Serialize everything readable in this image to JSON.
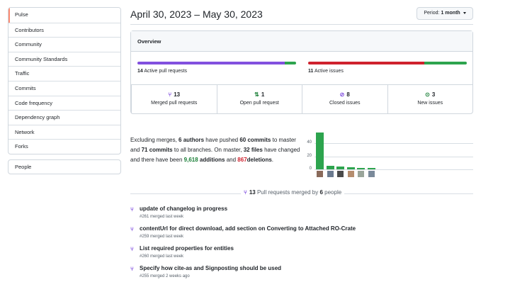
{
  "sidebar": {
    "items": [
      {
        "label": "Pulse"
      },
      {
        "label": "Contributors"
      },
      {
        "label": "Community"
      },
      {
        "label": "Community Standards"
      },
      {
        "label": "Traffic"
      },
      {
        "label": "Commits"
      },
      {
        "label": "Code frequency"
      },
      {
        "label": "Dependency graph"
      },
      {
        "label": "Network"
      },
      {
        "label": "Forks"
      }
    ],
    "people_label": "People"
  },
  "header": {
    "title": "April 30, 2023 – May 30, 2023",
    "period_label": "Period:",
    "period_value": "1 month"
  },
  "overview": {
    "title": "Overview",
    "active_prs": {
      "count": "14",
      "label": "Active pull requests",
      "merged_fraction": 0.93,
      "open_fraction": 0.07
    },
    "active_issues": {
      "count": "11",
      "label": "Active issues",
      "closed_fraction": 0.73,
      "new_fraction": 0.27
    },
    "stats": [
      {
        "icon": "merged-pr-icon",
        "num": "13",
        "label": "Merged pull requests",
        "color": "#8250df"
      },
      {
        "icon": "open-pr-icon",
        "num": "1",
        "label": "Open pull request",
        "color": "#1a7f37"
      },
      {
        "icon": "closed-issue-icon",
        "num": "8",
        "label": "Closed issues",
        "color": "#8250df"
      },
      {
        "icon": "new-issue-icon",
        "num": "3",
        "label": "New issues",
        "color": "#1a7f37"
      }
    ],
    "colors": {
      "merged": "#8250df",
      "open": "#2da44e",
      "closed": "#cf222e",
      "new": "#2da44e"
    }
  },
  "summary": {
    "p1": "Excluding merges,",
    "authors": "6 authors",
    "p2": "have pushed",
    "commits_master": "60 commits",
    "p3": "to master and",
    "commits_all": "71 commits",
    "p4": "to all branches. On master,",
    "files": "32 files",
    "p5": "have changed and there have been",
    "additions_num": "9,618",
    "additions_word": "additions",
    "p6": "and",
    "deletions_num": "867",
    "deletions_word": "deletions",
    "p7": "."
  },
  "chart_data": {
    "type": "bar",
    "categories": [
      "author-1",
      "author-2",
      "author-3",
      "author-4",
      "author-5",
      "author-6"
    ],
    "values": [
      57,
      5,
      4,
      3,
      2,
      2
    ],
    "ylim": [
      0,
      60
    ],
    "yticks": [
      "0",
      "20",
      "40"
    ],
    "bar_color": "#2da44e"
  },
  "merged": {
    "count": "13",
    "middle": "Pull requests merged by",
    "people": "6",
    "tail": "people"
  },
  "pull_requests": [
    {
      "title": "update of changelog in progress",
      "meta": "#261 merged last week"
    },
    {
      "title": "contentUrl for direct download, add section on Converting to Attached RO-Crate",
      "meta": "#259 merged last week"
    },
    {
      "title": "List required properties for entities",
      "meta": "#260 merged last week"
    },
    {
      "title": "Specify how cite-as and Signposting should be used",
      "meta": "#255 merged 2 weeks ago"
    }
  ]
}
